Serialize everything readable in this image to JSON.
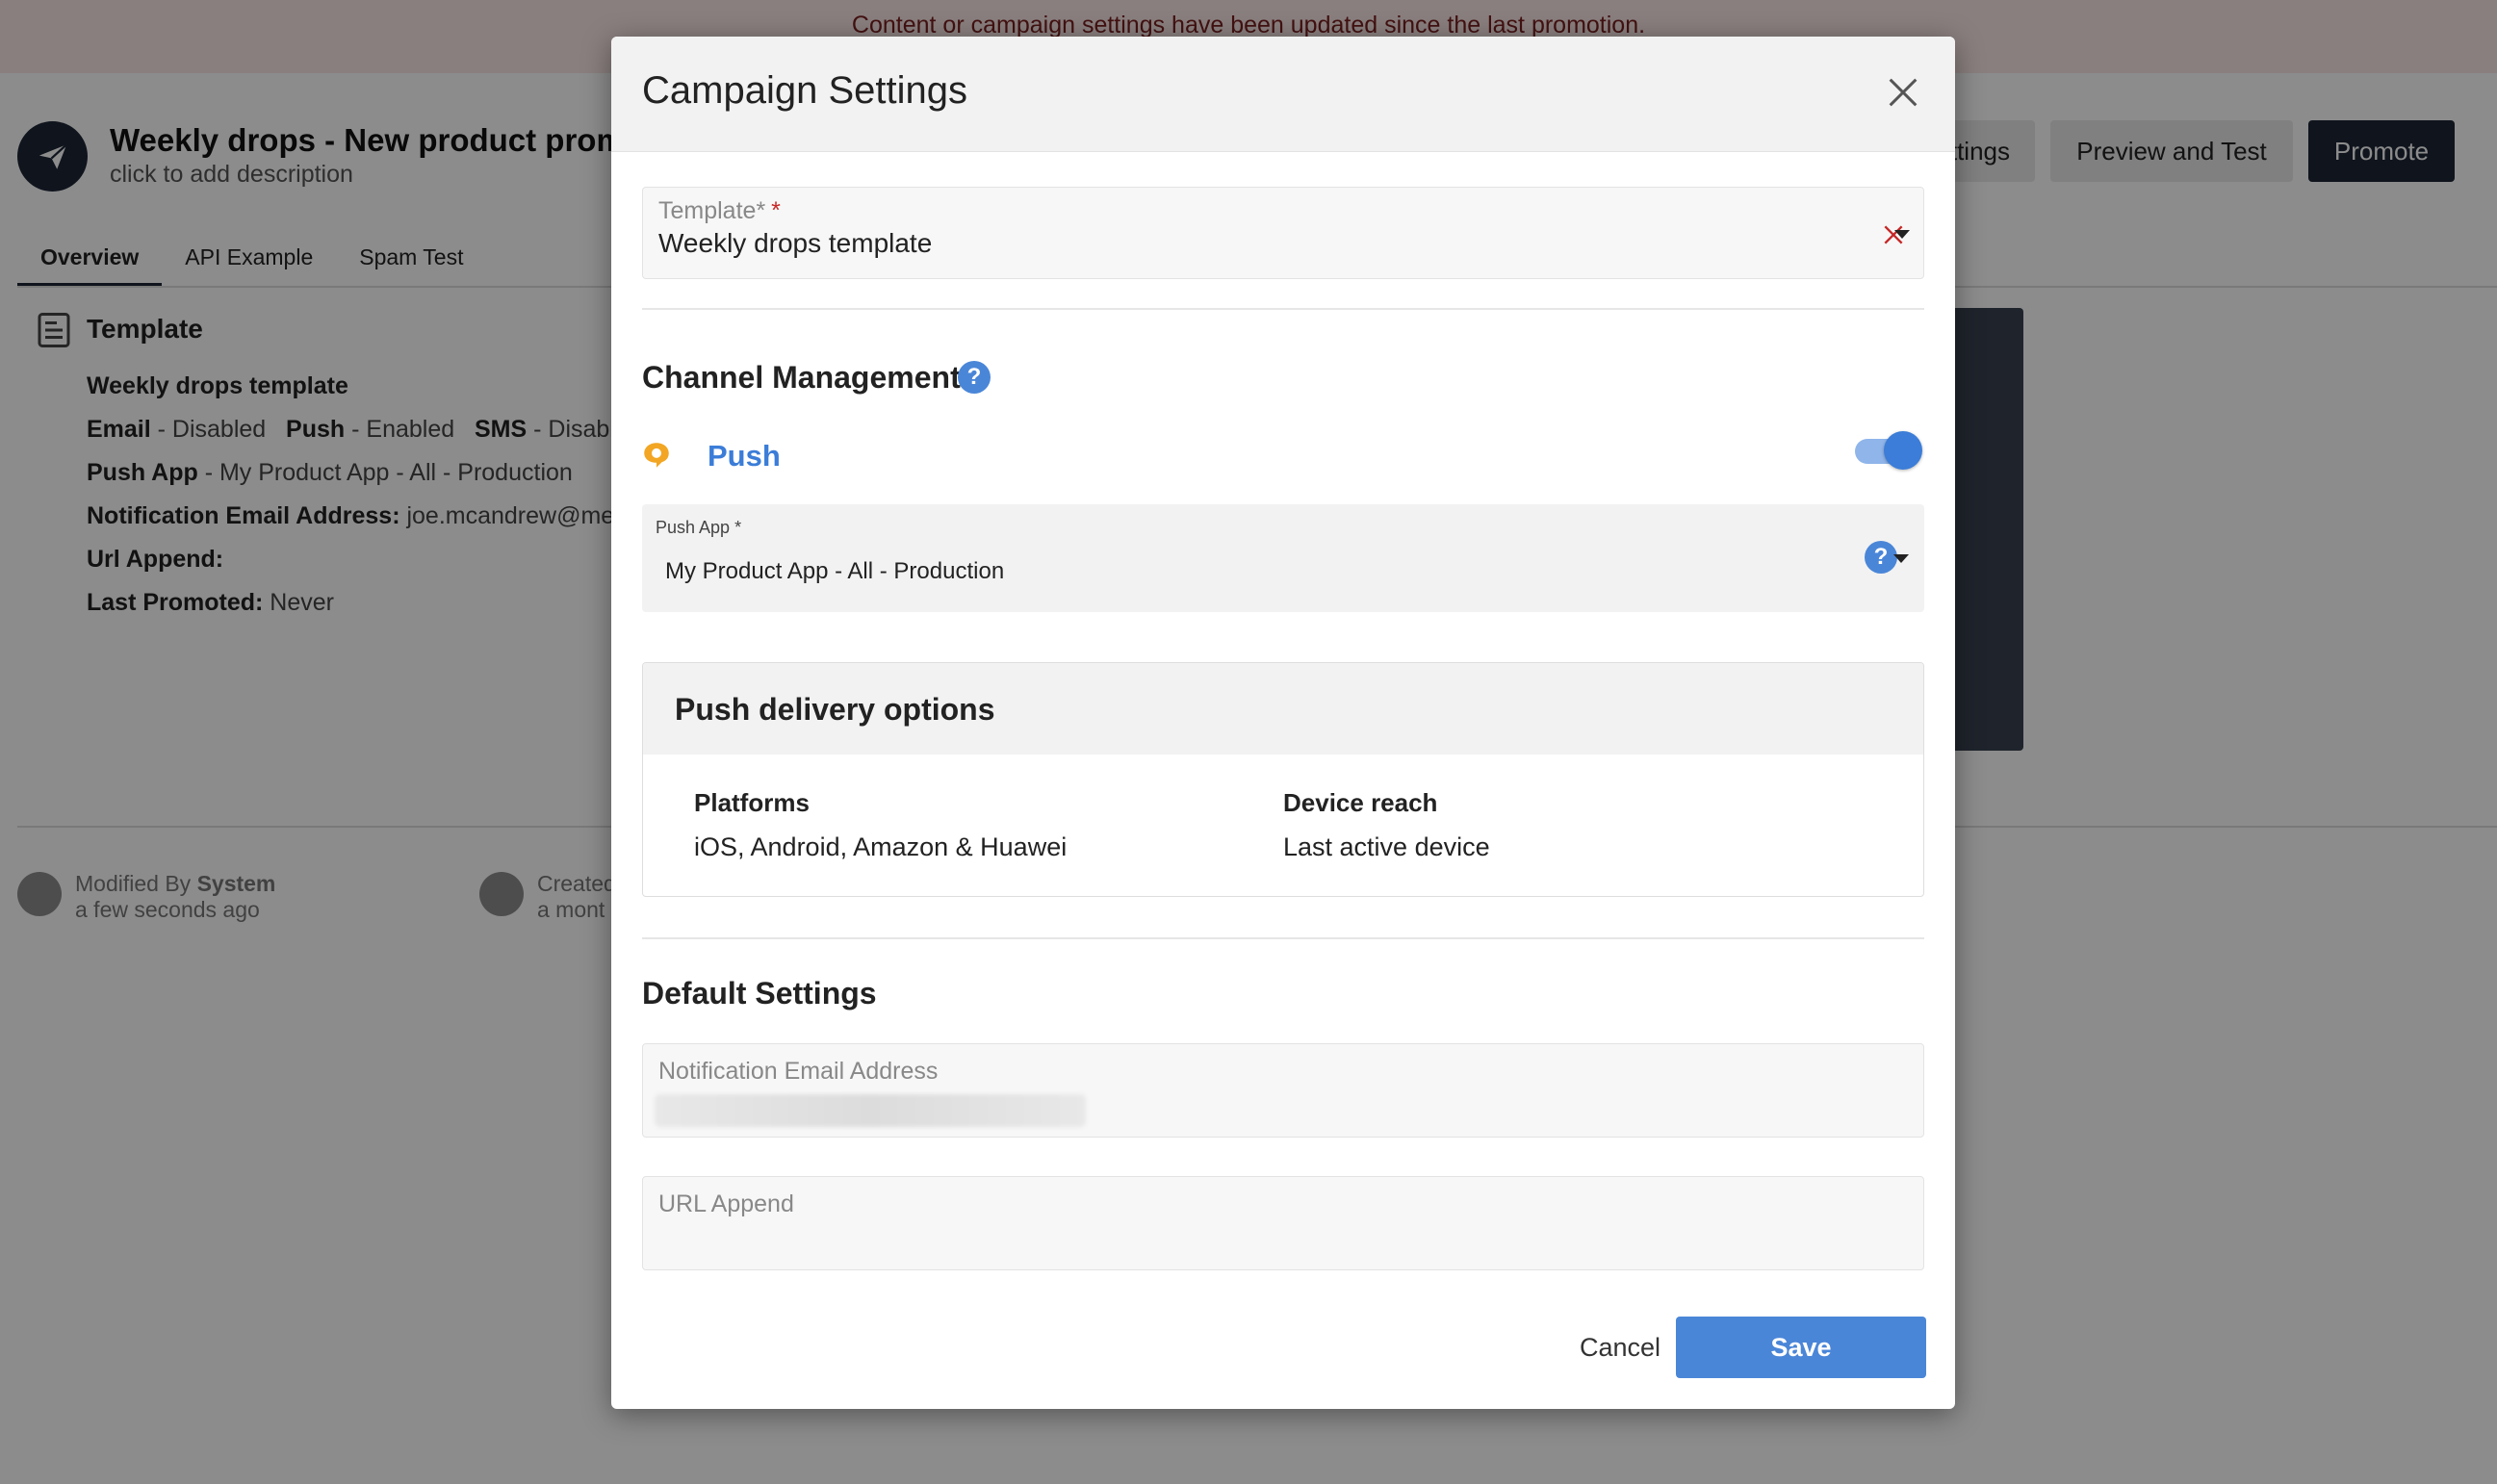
{
  "banner": {
    "text": "Content or campaign settings have been updated since the last promotion."
  },
  "campaign": {
    "title": "Weekly drops - New product promo",
    "description_placeholder": "click to add description"
  },
  "header_buttons": {
    "settings_partial": "ttings",
    "preview": "Preview and Test",
    "promote": "Promote"
  },
  "tabs": [
    {
      "label": "Overview",
      "active": true
    },
    {
      "label": "API Example",
      "active": false
    },
    {
      "label": "Spam Test",
      "active": false
    }
  ],
  "template_panel": {
    "heading": "Template",
    "template_name": "Weekly drops template",
    "channels": {
      "email_label": "Email",
      "email_status": " - Disabled",
      "push_label": "Push",
      "push_status": " - Enabled",
      "sms_label": "SMS",
      "sms_status": " - Disable"
    },
    "push_app_label": "Push App",
    "push_app_value": " - My Product App - All - Production",
    "notification_email_label": "Notification Email Address:",
    "notification_email_value": " joe.mcandrew@me",
    "url_append_label": "Url Append:",
    "last_promoted_label": "Last Promoted:",
    "last_promoted_value": " Never"
  },
  "meta": {
    "modified_prefix": "Modified By ",
    "modified_by": "System",
    "modified_time": "a few seconds ago",
    "created_prefix": "Created",
    "created_time": "a mont"
  },
  "modal": {
    "title": "Campaign Settings",
    "template_field": {
      "label": "Template*",
      "required_mark": "*",
      "value": "Weekly drops template"
    },
    "channel_management": {
      "title": "Channel Management",
      "help": "?",
      "push_label": "Push",
      "push_enabled": true
    },
    "push_app": {
      "label": "Push App *",
      "value": "My Product App - All - Production",
      "help": "?"
    },
    "delivery": {
      "title": "Push delivery options",
      "platforms_label": "Platforms",
      "platforms_value": "iOS, Android, Amazon & Huawei",
      "reach_label": "Device reach",
      "reach_value": "Last active device"
    },
    "default_settings": {
      "title": "Default Settings",
      "notification_email_label": "Notification Email Address",
      "url_append_label": "URL Append"
    },
    "buttons": {
      "cancel": "Cancel",
      "save": "Save"
    }
  },
  "colors": {
    "accent": "#4a86d8",
    "push_label": "#3b7dd8",
    "dark_button": "#1c2636",
    "required": "#c62828"
  }
}
